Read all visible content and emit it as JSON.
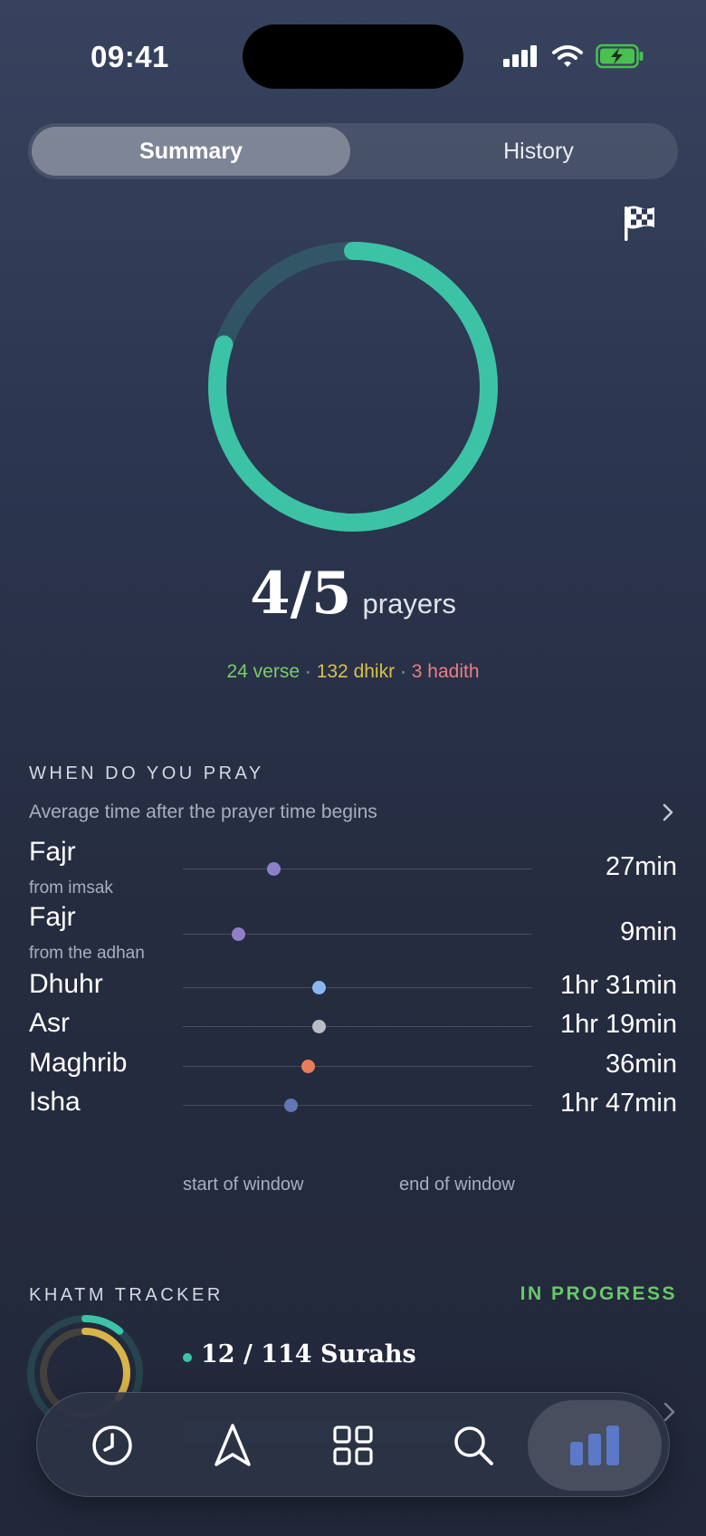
{
  "status_bar": {
    "time": "09:41"
  },
  "segmented": {
    "summary_label": "Summary",
    "history_label": "History",
    "selected": "Summary"
  },
  "summary": {
    "completed": "4/5",
    "unit": "prayers",
    "progress_fraction": 0.8,
    "stats": {
      "verse": "24 verse",
      "dhikr": "132 dhikr",
      "hadith": "3 hadith",
      "separator": "·"
    }
  },
  "when_do_you_pray": {
    "title": "WHEN DO YOU PRAY",
    "subtitle": "Average time after the prayer time begins",
    "start_label": "start of window",
    "end_label": "end of window",
    "rows": [
      {
        "name": "Fajr",
        "sub": "from imsak",
        "time": "27min",
        "position": 0.26,
        "color": "#8d80c9"
      },
      {
        "name": "Fajr",
        "sub": "from the adhan",
        "time": "9min",
        "position": 0.16,
        "color": "#8d80c9"
      },
      {
        "name": "Dhuhr",
        "sub": "",
        "time": "1hr 31min",
        "position": 0.39,
        "color": "#8ab7ef"
      },
      {
        "name": "Asr",
        "sub": "",
        "time": "1hr 19min",
        "position": 0.39,
        "color": "#b9bcc4"
      },
      {
        "name": "Maghrib",
        "sub": "",
        "time": "36min",
        "position": 0.36,
        "color": "#e97d5b"
      },
      {
        "name": "Isha",
        "sub": "",
        "time": "1hr 47min",
        "position": 0.31,
        "color": "#6276b4"
      }
    ]
  },
  "khatm": {
    "title": "KHATM TRACKER",
    "status": "IN PROGRESS",
    "surahs": "12 / 114 Surahs",
    "teal_progress": 0.11,
    "gold_progress": 0.35
  },
  "tab_bar": {
    "items": [
      "clock-icon",
      "compass-arrow-icon",
      "grid-icon",
      "search-icon",
      "stats-bars-icon"
    ],
    "active": "stats-bars-icon"
  },
  "colors": {
    "accent_teal": "#3cc3a6",
    "in_progress_green": "#69c86a",
    "bar_blue": "#5b79c8"
  }
}
